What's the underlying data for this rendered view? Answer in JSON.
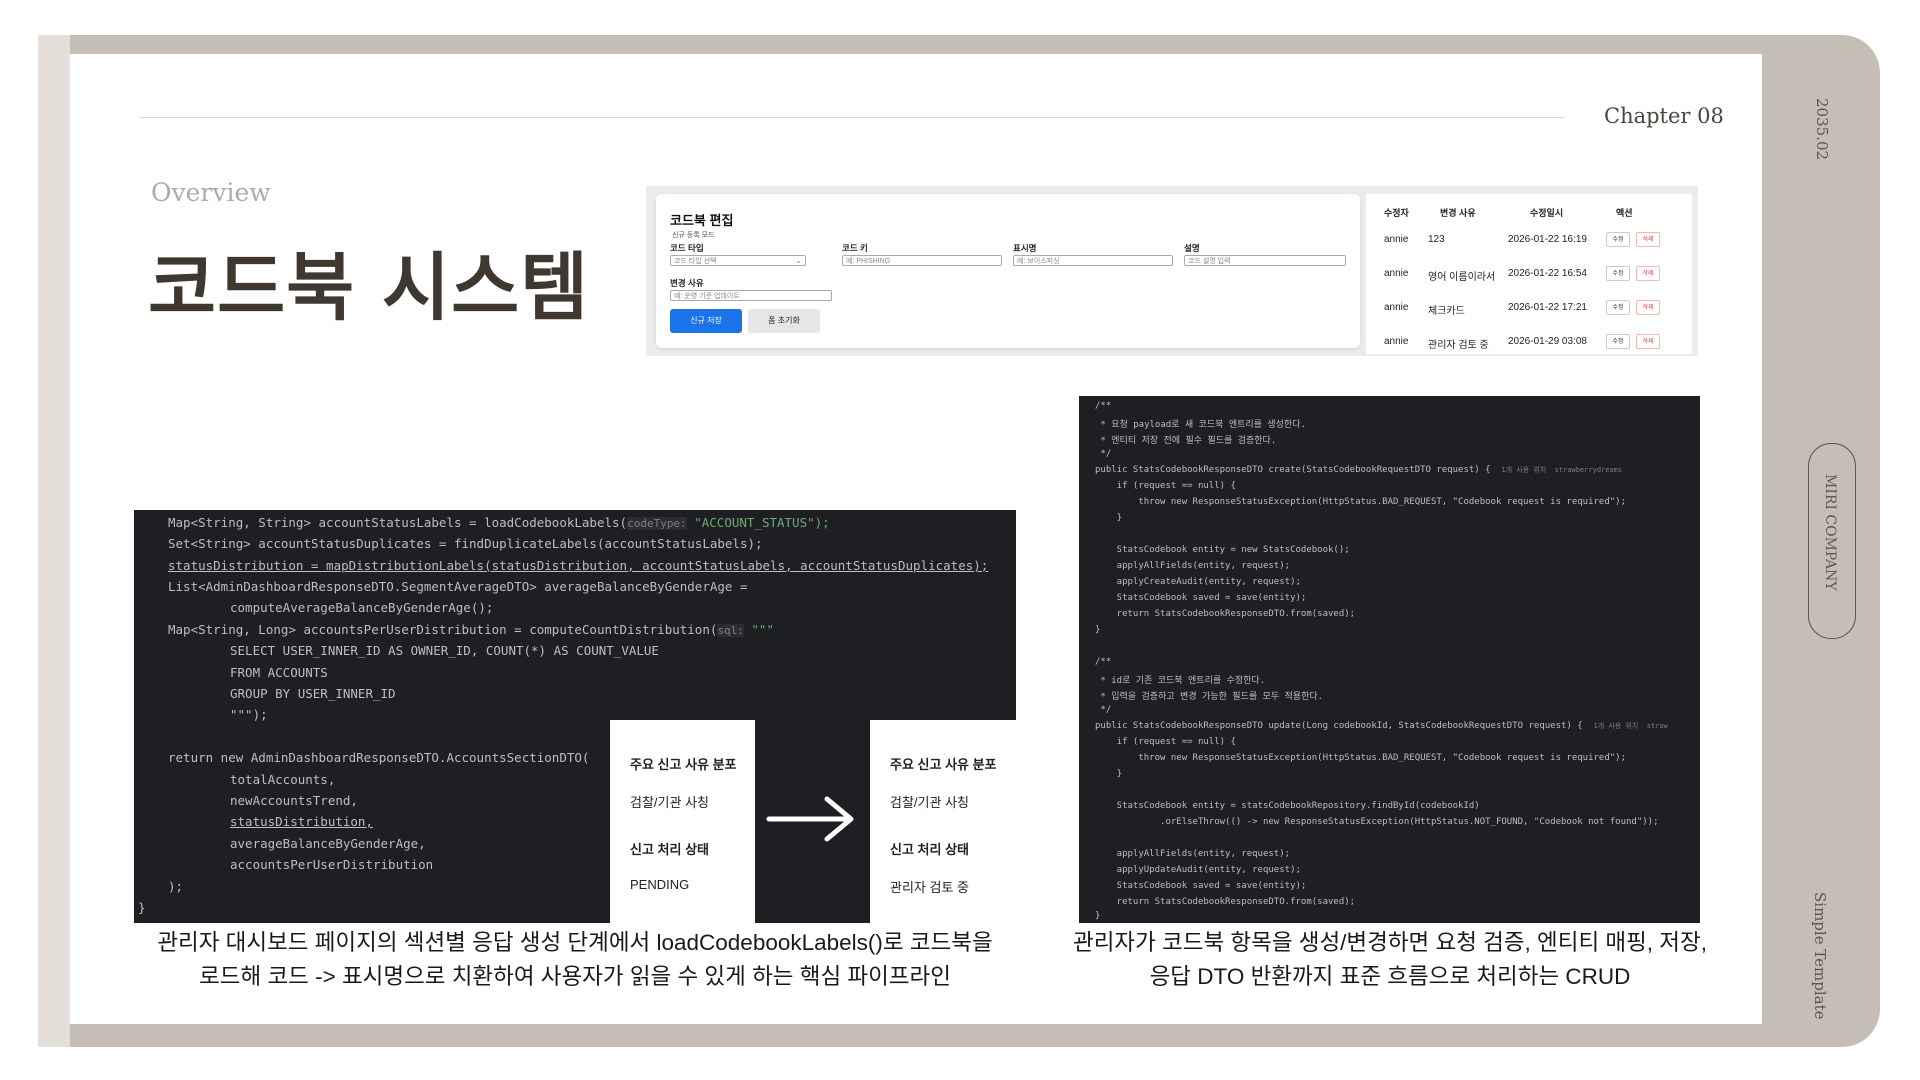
{
  "side": {
    "date": "2035.02",
    "company": "MIRI COMPANY",
    "template": "Simple Template"
  },
  "header": {
    "chapter": "Chapter 08",
    "overview": "Overview",
    "title": "코드북 시스템"
  },
  "editor": {
    "title": "코드북 편집",
    "subtitle": "신규 등록 모드",
    "fields": [
      {
        "label": "코드 타입",
        "value": "코드 타입 선택"
      },
      {
        "label": "코드 키",
        "value": "예: PHISHING"
      },
      {
        "label": "표시명",
        "value": "예: 보이스피싱"
      },
      {
        "label": "설명",
        "value": "코드 설명 입력"
      }
    ],
    "reason_label": "변경 사유",
    "reason_placeholder": "예: 운영 기준 업데이트",
    "save_button": "신규 저장",
    "reset_button": "폼 초기화"
  },
  "history": {
    "headers": [
      "수정자",
      "변경 사유",
      "수정일시",
      "액션"
    ],
    "rows": [
      {
        "editor": "annie",
        "reason": "123",
        "date": "2026-01-22 16:19"
      },
      {
        "editor": "annie",
        "reason": "영어 이름이라서",
        "date": "2026-01-22 16:54"
      },
      {
        "editor": "annie",
        "reason": "체크카드",
        "date": "2026-01-22 17:21"
      },
      {
        "editor": "annie",
        "reason": "관리자 검토 중",
        "date": "2026-01-29 03:08"
      }
    ],
    "edit_label": "수정",
    "delete_label": "삭제"
  },
  "code1": {
    "l1a": "Map<String, String> accountStatusLabels = loadCodebookLabels(",
    "l1hint": "codeType:",
    "l1b": "\"ACCOUNT_STATUS\");",
    "l2": "Set<String> accountStatusDuplicates = findDuplicateLabels(accountStatusLabels);",
    "l3": "statusDistribution = mapDistributionLabels(statusDistribution, accountStatusLabels, accountStatusDuplicates);",
    "l4": "List<AdminDashboardResponseDTO.SegmentAverageDTO> averageBalanceByGenderAge =",
    "l5": "computeAverageBalanceByGenderAge();",
    "l6a": "Map<String, Long> accountsPerUserDistribution = computeCountDistribution(",
    "l6hint": "sql:",
    "l6b": "\"\"\"",
    "l7": "SELECT USER_INNER_ID AS OWNER_ID, COUNT(*) AS COUNT_VALUE",
    "l8": "FROM ACCOUNTS",
    "l9": "GROUP BY USER_INNER_ID",
    "l10": "\"\"\");",
    "l11": "return new AdminDashboardResponseDTO.AccountsSectionDTO(",
    "l12": "totalAccounts,",
    "l13": "newAccountsTrend,",
    "l14": "statusDistribution,",
    "l15": "averageBalanceByGenderAge,",
    "l16": "accountsPerUserDistribution",
    "l17": ");",
    "l18": "}"
  },
  "before_panel": {
    "t1": "주요 신고 사유 분포",
    "v1": "검찰/기관 사칭",
    "t2": "신고 처리 상태",
    "v2": "PENDING"
  },
  "after_panel": {
    "t1": "주요 신고 사유 분포",
    "v1": "검찰/기관 사칭",
    "t2": "신고 처리 상태",
    "v2": "관리자 검토 중"
  },
  "code2": {
    "c1": "/**",
    "c2": " * 요청 payload로 새 코드북 엔트리를 생성한다.",
    "c3": " * 엔티티 저장 전에 필수 필드를 검증한다.",
    "c4": " */",
    "m1": "public StatsCodebookResponseDTO create(StatsCodebookRequestDTO request) {",
    "m1hint": "1개 사용 위치  strawberrydreams",
    "m2": "    if (request == null) {",
    "m3": "        throw new ResponseStatusException(HttpStatus.BAD_REQUEST, \"Codebook request is required\");",
    "m4": "    }",
    "m5": "    StatsCodebook entity = new StatsCodebook();",
    "m6": "    applyAllFields(entity, request);",
    "m7": "    applyCreateAudit(entity, request);",
    "m8": "    StatsCodebook saved = save(entity);",
    "m9": "    return StatsCodebookResponseDTO.from(saved);",
    "m10": "}",
    "d1": "/**",
    "d2": " * id로 기존 코드북 엔트리를 수정한다.",
    "d3": " * 입력을 검증하고 변경 가능한 필드를 모두 적용한다.",
    "d4": " */",
    "u1": "public StatsCodebookResponseDTO update(Long codebookId, StatsCodebookRequestDTO request) {",
    "u1hint": "1개 사용 위치  straw",
    "u2": "    if (request == null) {",
    "u3": "        throw new ResponseStatusException(HttpStatus.BAD_REQUEST, \"Codebook request is required\");",
    "u4": "    }",
    "u5": "    StatsCodebook entity = statsCodebookRepository.findById(codebookId)",
    "u6": "            .orElseThrow(() -> new ResponseStatusException(HttpStatus.NOT_FOUND, \"Codebook not found\"));",
    "u7": "    applyAllFields(entity, request);",
    "u8": "    applyUpdateAudit(entity, request);",
    "u9": "    StatsCodebook saved = save(entity);",
    "u10": "    return StatsCodebookResponseDTO.from(saved);",
    "u11": "}"
  },
  "captions": {
    "left1": "관리자 대시보드 페이지의 섹션별 응답 생성 단계에서 loadCodebookLabels()로  코드북을",
    "left2": "로드해 코드 -> 표시명으로 치환하여 사용자가 읽을 수 있게 하는 핵심 파이프라인",
    "right1": "관리자가 코드북 항목을 생성/변경하면 요청 검증, 엔티티 매핑, 저장,",
    "right2": "응답 DTO 반환까지 표준 흐름으로 처리하는 CRUD"
  },
  "colors": {
    "frame": "#c4beb4",
    "title": "#3f3831",
    "accent_blue": "#1a73e8",
    "code_bg": "#1e1f22"
  }
}
